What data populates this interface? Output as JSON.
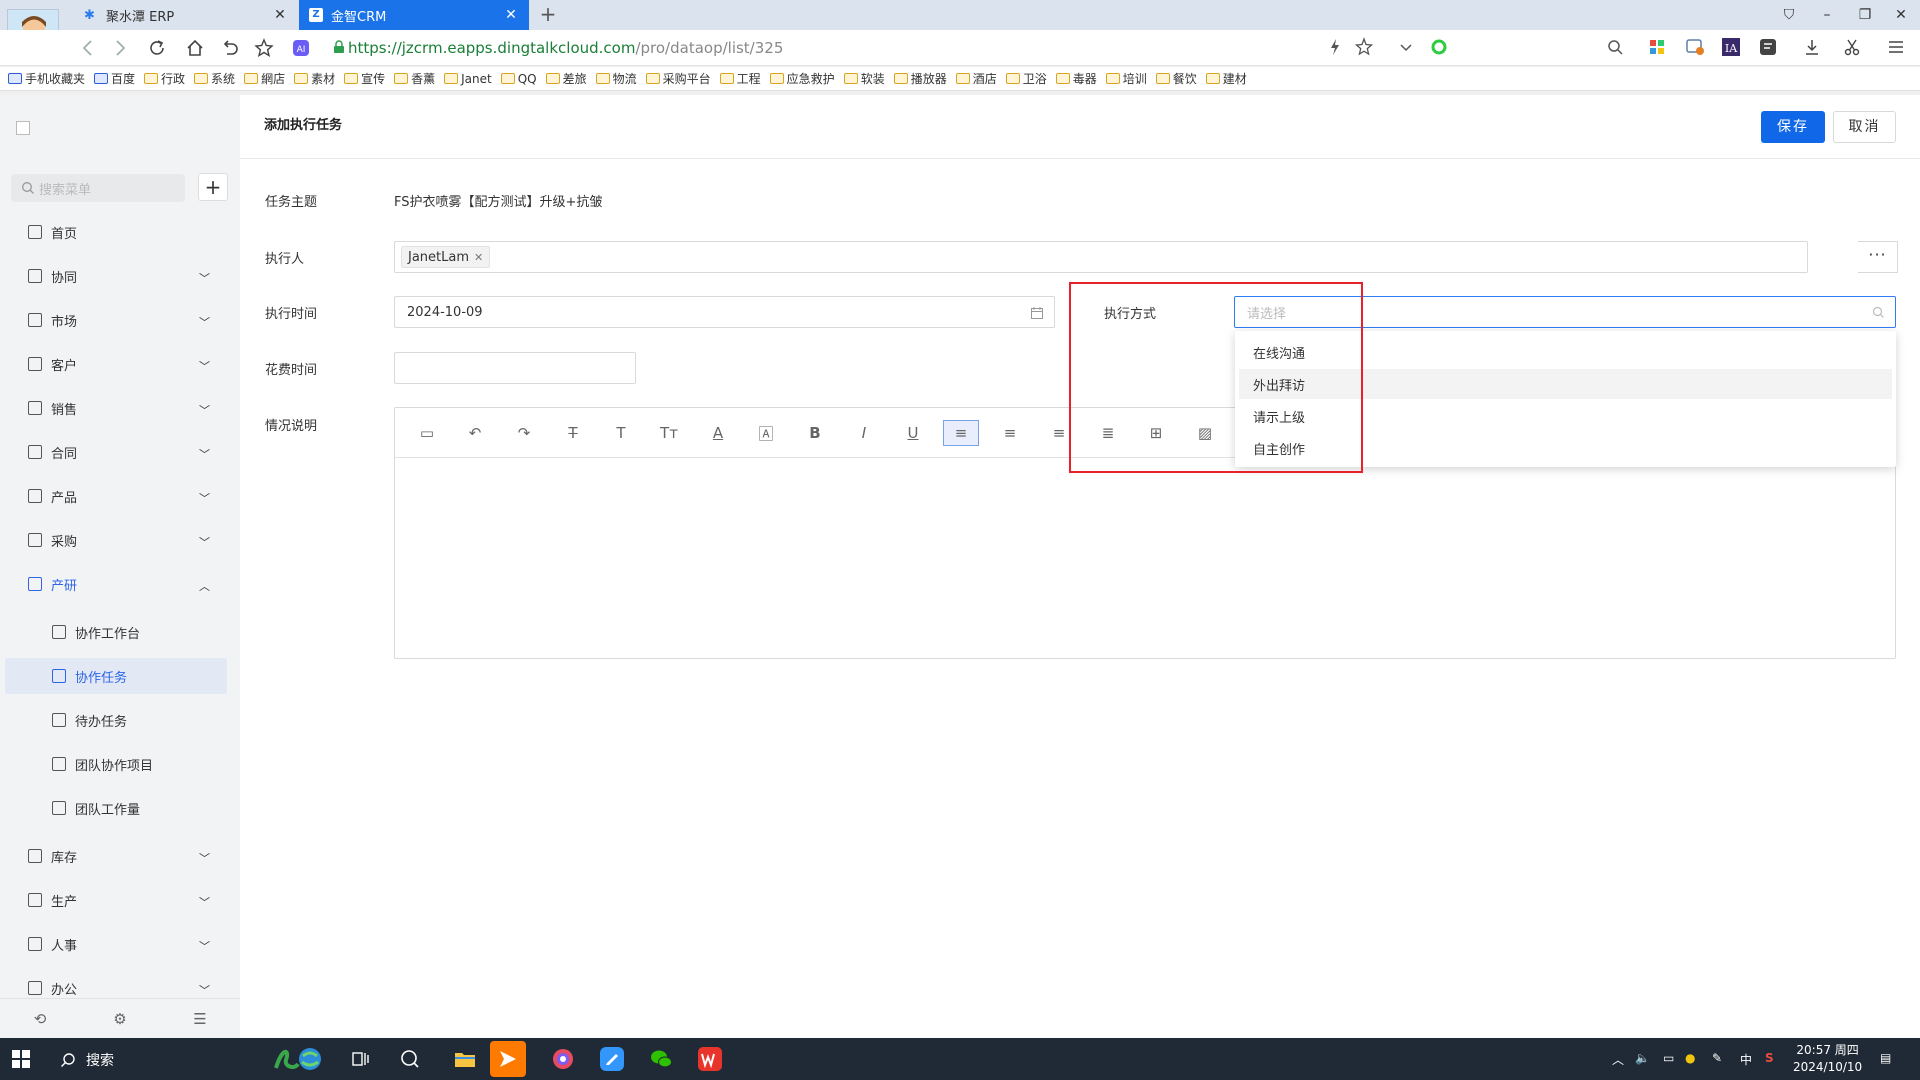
{
  "browser": {
    "tabs": [
      {
        "title": "聚水潭 ERP"
      },
      {
        "title": "金智CRM"
      }
    ],
    "url_host": "https://jzcrm.eapps.dingtalkcloud.com",
    "url_path": "/pro/dataop/list/325",
    "bookmarks": [
      "手机收藏夹",
      "百度",
      "行政",
      "系统",
      "網店",
      "素材",
      "宣传",
      "香薰",
      "Janet",
      "QQ",
      "差旅",
      "物流",
      "采购平台",
      "工程",
      "应急救护",
      "软装",
      "播放器",
      "酒店",
      "卫浴",
      "毒器",
      "培训",
      "餐饮",
      "建材"
    ]
  },
  "sidebar": {
    "search_placeholder": "搜索菜单",
    "add_label": "+",
    "items": [
      {
        "label": "首页",
        "expandable": false
      },
      {
        "label": "协同",
        "expandable": true
      },
      {
        "label": "市场",
        "expandable": true
      },
      {
        "label": "客户",
        "expandable": true
      },
      {
        "label": "销售",
        "expandable": true
      },
      {
        "label": "合同",
        "expandable": true
      },
      {
        "label": "产品",
        "expandable": true
      },
      {
        "label": "采购",
        "expandable": true
      },
      {
        "label": "产研",
        "expandable": true,
        "expanded": true
      }
    ],
    "sub_items": [
      {
        "label": "协作工作台"
      },
      {
        "label": "协作任务",
        "selected": true
      },
      {
        "label": "待办任务"
      },
      {
        "label": "团队协作项目"
      },
      {
        "label": "团队工作量"
      }
    ],
    "items_after": [
      {
        "label": "库存"
      },
      {
        "label": "生产"
      },
      {
        "label": "人事"
      },
      {
        "label": "办公"
      }
    ]
  },
  "form": {
    "title": "添加执行任务",
    "save_label": "保存",
    "cancel_label": "取消",
    "subject_label": "任务主题",
    "subject_value": "FS护衣喷雾【配方测试】升级+抗皱",
    "executor_label": "执行人",
    "executor_tag": "JanetLam",
    "more_label": "···",
    "exec_time_label": "执行时间",
    "exec_time_value": "2024-10-09",
    "method_label": "执行方式",
    "method_placeholder": "请选择",
    "spend_time_label": "花费时间",
    "spend_time_value": "",
    "desc_label": "情况说明"
  },
  "dropdown": {
    "options": [
      "在线沟通",
      "外出拜访",
      "请示上级",
      "自主创作"
    ],
    "hovered_index": 1
  },
  "taskbar": {
    "search_label": "搜索",
    "clock_time": "20:57 周四",
    "clock_date": "2024/10/10",
    "ime": "中"
  },
  "colors": {
    "primary": "#1067e8",
    "active_tab": "#1a73e8",
    "highlight_box": "#e8222a",
    "menu_active": "#2d66e8"
  }
}
